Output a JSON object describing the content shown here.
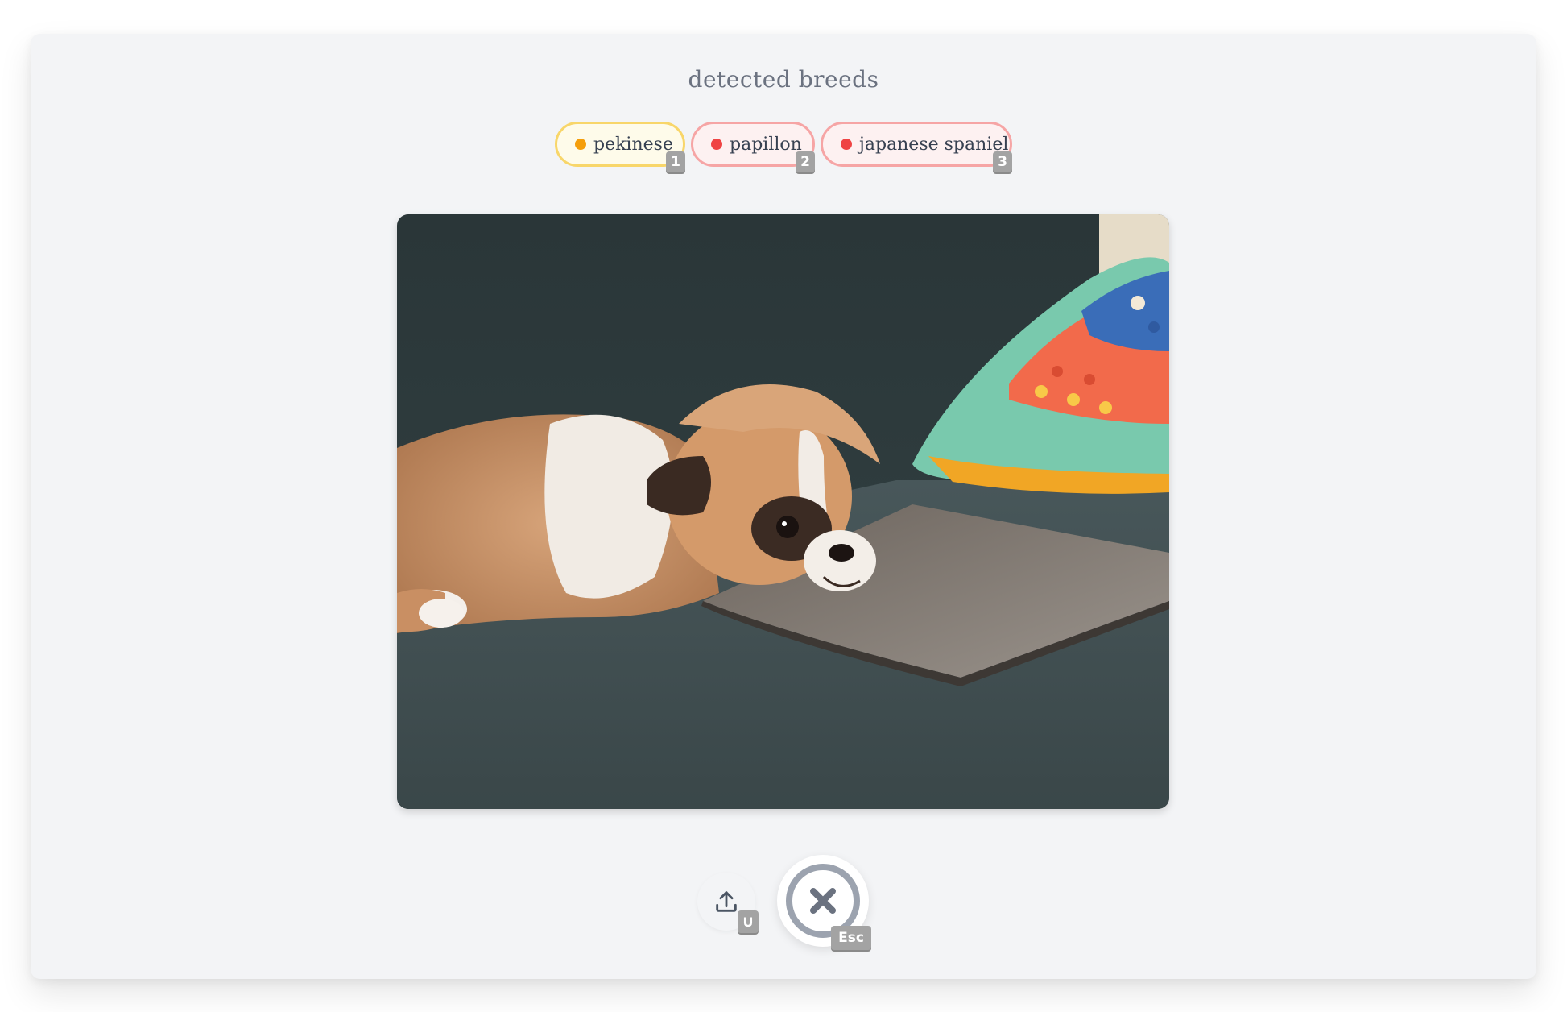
{
  "header": {
    "title": "detected breeds"
  },
  "breeds": [
    {
      "label": "pekinese",
      "shortcut": "1",
      "color": "#f59e0b",
      "border": "#f8d66a"
    },
    {
      "label": "papillon",
      "shortcut": "2",
      "color": "#ef4444",
      "border": "#f6a5a5"
    },
    {
      "label": "japanese spaniel",
      "shortcut": "3",
      "color": "#ef4444",
      "border": "#f6a5a5"
    }
  ],
  "image": {
    "subject": "dog-resting-on-laptop-photo"
  },
  "actions": {
    "upload": {
      "icon": "upload-icon",
      "shortcut": "U"
    },
    "close": {
      "icon": "close-circle-icon",
      "shortcut": "Esc"
    }
  }
}
